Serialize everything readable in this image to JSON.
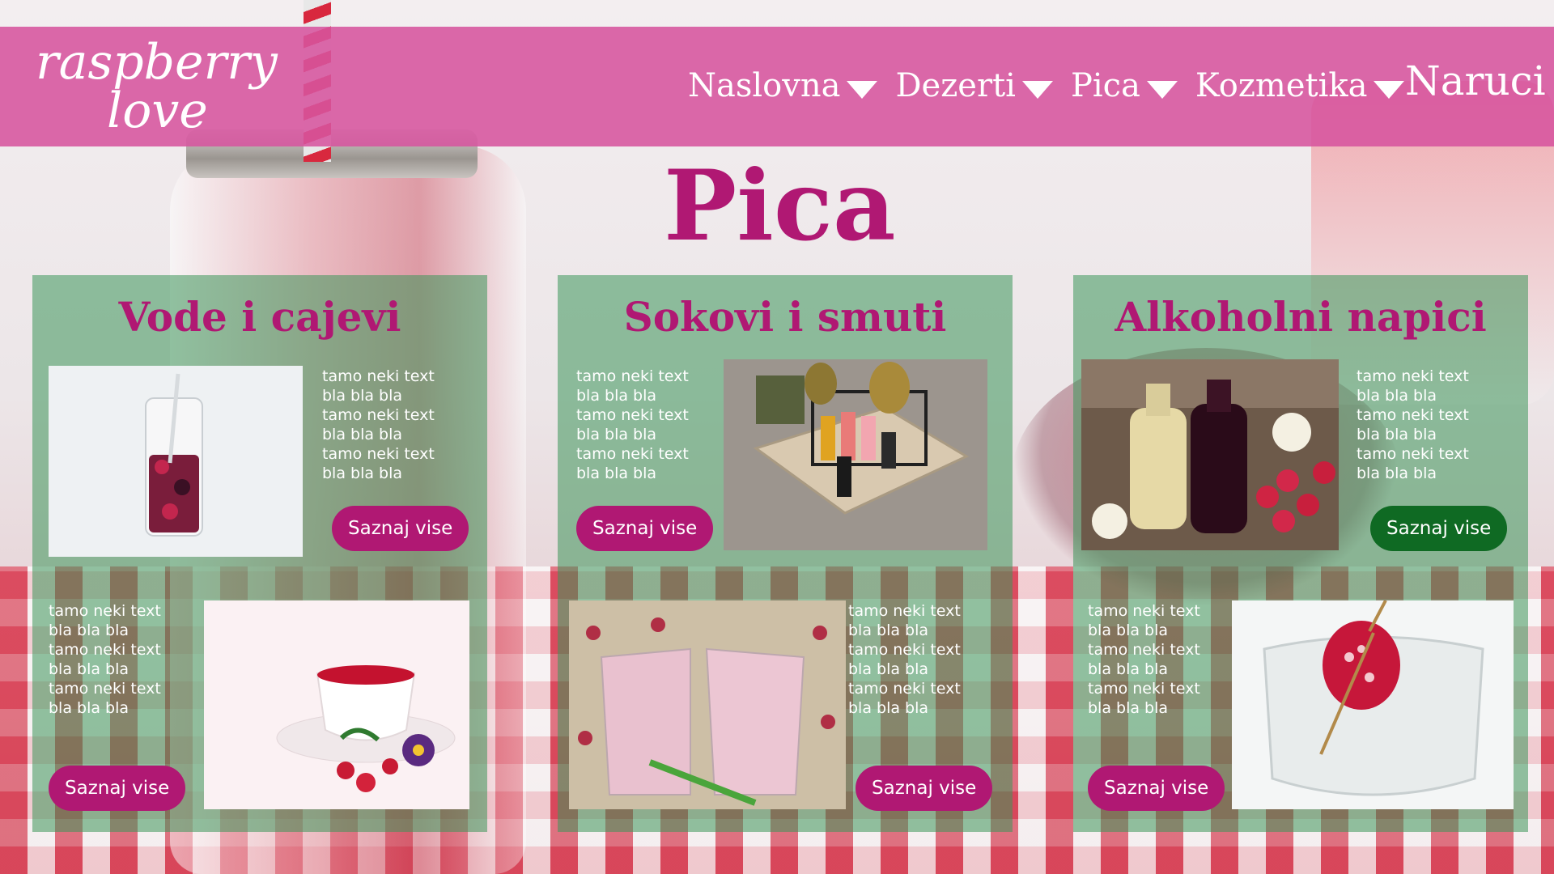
{
  "brand": {
    "line1": "raspberry",
    "line2": "love"
  },
  "nav": {
    "items": [
      {
        "label": "Naslovna"
      },
      {
        "label": "Dezerti"
      },
      {
        "label": "Pica"
      },
      {
        "label": "Kozmetika"
      }
    ],
    "cta": "Naruci"
  },
  "page_title": "Pica",
  "blurb_lines": [
    "tamo neki text",
    "bla bla bla",
    "tamo neki text",
    "bla bla bla",
    "tamo neki text",
    "bla bla bla"
  ],
  "cards": [
    {
      "title": "Vode i cajevi",
      "items": [
        {
          "button": "Saznaj vise",
          "image": "berry-water-glass"
        },
        {
          "button": "Saznaj vise",
          "image": "raspberry-tea-cup"
        }
      ]
    },
    {
      "title": "Sokovi i smuti",
      "items": [
        {
          "button": "Saznaj vise",
          "image": "juice-bottles-crate"
        },
        {
          "button": "Saznaj vise",
          "image": "raspberry-smoothies"
        }
      ]
    },
    {
      "title": "Alkoholni napici",
      "items": [
        {
          "button": "Saznaj vise",
          "image": "liqueur-bottles-berries"
        },
        {
          "button": "Saznaj vise",
          "image": "raspberry-in-glass"
        }
      ]
    }
  ],
  "colors": {
    "header": "#d6549e",
    "accent": "#b01873",
    "button_primary": "#b01873",
    "button_alt": "#0f6a23",
    "card_overlay": "#3c965a"
  }
}
